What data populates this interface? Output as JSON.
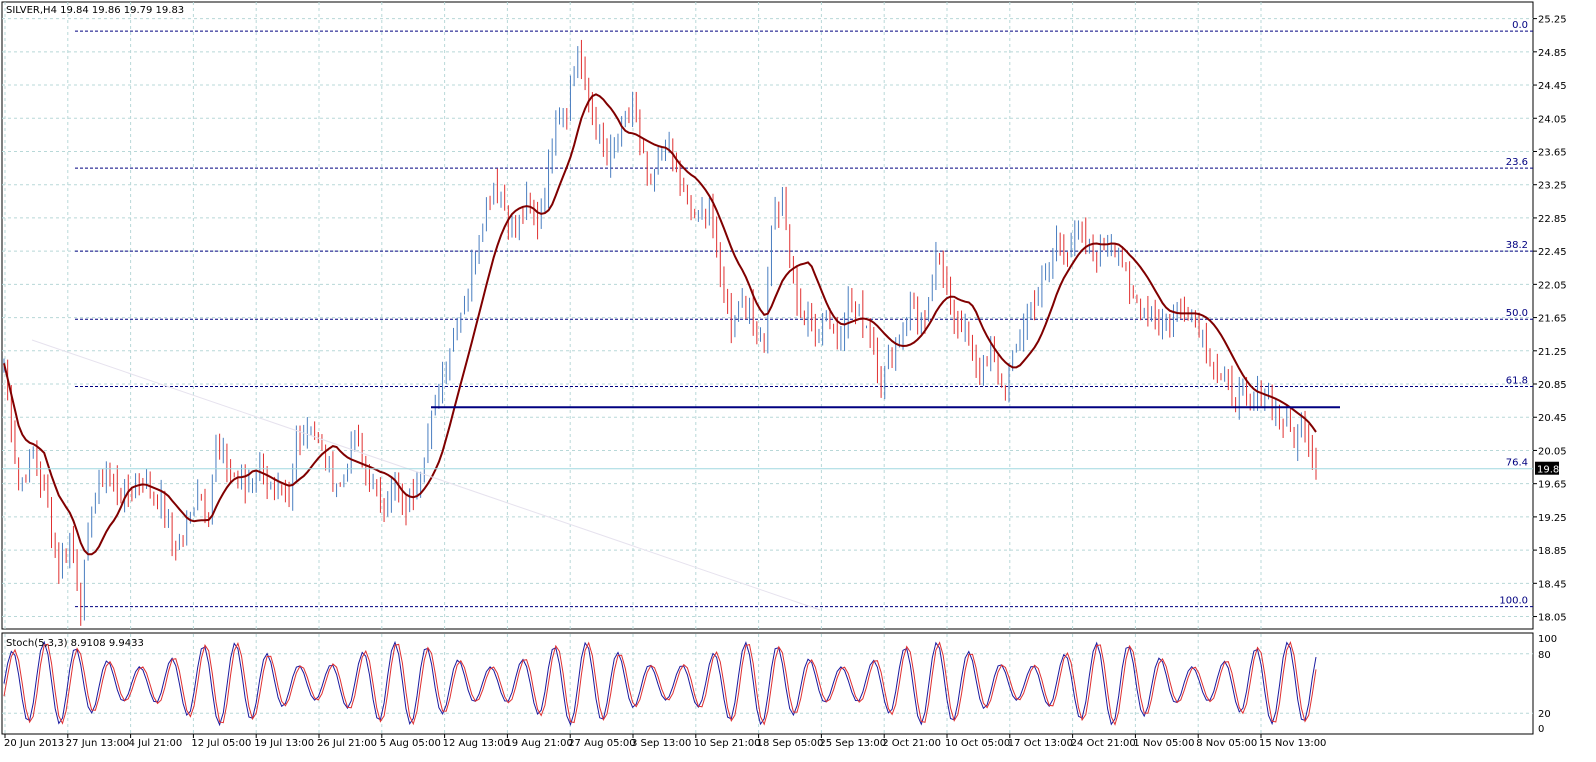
{
  "chart_data": {
    "type": "candlestick",
    "symbol_header": "SILVER,H4  19.84 19.86 19.79 19.83",
    "current_price": "19.83",
    "price_ylim": [
      17.9,
      25.45
    ],
    "price_ticks": [
      "25.25",
      "24.85",
      "24.45",
      "24.05",
      "23.65",
      "23.25",
      "22.85",
      "22.45",
      "22.05",
      "21.65",
      "21.25",
      "20.85",
      "20.45",
      "20.05",
      "19.65",
      "19.25",
      "18.85",
      "18.45",
      "18.05"
    ],
    "x_ticks": [
      "20 Jun 2013",
      "27 Jun 13:00",
      "4 Jul 21:00",
      "12 Jul 05:00",
      "19 Jul 13:00",
      "26 Jul 21:00",
      "5 Aug 05:00",
      "12 Aug 13:00",
      "19 Aug 21:00",
      "27 Aug 05:00",
      "3 Sep 13:00",
      "10 Sep 21:00",
      "18 Sep 05:00",
      "25 Sep 13:00",
      "2 Oct 21:00",
      "10 Oct 05:00",
      "17 Oct 13:00",
      "24 Oct 21:00",
      "1 Nov 05:00",
      "8 Nov 05:00",
      "15 Nov 13:00"
    ],
    "fibonacci": [
      {
        "label": "0.0",
        "price": 25.1
      },
      {
        "label": "23.6",
        "price": 23.45
      },
      {
        "label": "38.2",
        "price": 22.45
      },
      {
        "label": "50.0",
        "price": 21.63
      },
      {
        "label": "61.8",
        "price": 20.82
      },
      {
        "label": "76.4",
        "price": 19.83
      },
      {
        "label": "100.0",
        "price": 18.17
      }
    ],
    "support_level": 20.57,
    "price_anchors": [
      [
        0,
        21.1
      ],
      [
        4,
        19.6
      ],
      [
        8,
        20.0
      ],
      [
        12,
        19.4
      ],
      [
        15,
        18.6
      ],
      [
        18,
        19.0
      ],
      [
        21,
        18.2
      ],
      [
        24,
        19.4
      ],
      [
        28,
        19.8
      ],
      [
        33,
        19.5
      ],
      [
        38,
        19.7
      ],
      [
        43,
        19.4
      ],
      [
        46,
        18.9
      ],
      [
        50,
        19.1
      ],
      [
        53,
        19.6
      ],
      [
        56,
        19.3
      ],
      [
        58,
        20.1
      ],
      [
        62,
        19.8
      ],
      [
        66,
        19.6
      ],
      [
        70,
        19.9
      ],
      [
        74,
        19.5
      ],
      [
        78,
        19.4
      ],
      [
        80,
        20.2
      ],
      [
        84,
        20.4
      ],
      [
        88,
        19.9
      ],
      [
        92,
        19.6
      ],
      [
        96,
        20.2
      ],
      [
        99,
        19.8
      ],
      [
        103,
        19.4
      ],
      [
        107,
        19.6
      ],
      [
        109,
        19.3
      ],
      [
        112,
        19.6
      ],
      [
        116,
        20.2
      ],
      [
        119,
        20.8
      ],
      [
        123,
        21.5
      ],
      [
        127,
        22.0
      ],
      [
        131,
        22.9
      ],
      [
        134,
        23.3
      ],
      [
        137,
        23.0
      ],
      [
        140,
        22.7
      ],
      [
        143,
        23.0
      ],
      [
        146,
        22.8
      ],
      [
        149,
        23.4
      ],
      [
        151,
        24.1
      ],
      [
        154,
        24.2
      ],
      [
        157,
        24.9
      ],
      [
        159,
        24.4
      ],
      [
        162,
        24.0
      ],
      [
        165,
        23.5
      ],
      [
        169,
        23.9
      ],
      [
        172,
        24.2
      ],
      [
        174,
        23.7
      ],
      [
        177,
        23.2
      ],
      [
        181,
        23.8
      ],
      [
        184,
        23.4
      ],
      [
        187,
        23.0
      ],
      [
        190,
        22.8
      ],
      [
        193,
        23.0
      ],
      [
        196,
        22.1
      ],
      [
        199,
        21.6
      ],
      [
        202,
        21.9
      ],
      [
        205,
        21.6
      ],
      [
        208,
        21.4
      ],
      [
        210,
        22.8
      ],
      [
        213,
        23.0
      ],
      [
        216,
        22.1
      ],
      [
        219,
        21.6
      ],
      [
        222,
        21.5
      ],
      [
        225,
        21.7
      ],
      [
        228,
        21.4
      ],
      [
        231,
        21.8
      ],
      [
        234,
        21.7
      ],
      [
        237,
        21.5
      ],
      [
        240,
        20.8
      ],
      [
        243,
        21.3
      ],
      [
        246,
        21.6
      ],
      [
        249,
        21.8
      ],
      [
        252,
        21.5
      ],
      [
        255,
        22.3
      ],
      [
        258,
        22.1
      ],
      [
        261,
        21.5
      ],
      [
        264,
        21.4
      ],
      [
        267,
        21.0
      ],
      [
        270,
        21.2
      ],
      [
        273,
        20.8
      ],
      [
        276,
        21.1
      ],
      [
        279,
        21.6
      ],
      [
        282,
        21.9
      ],
      [
        285,
        22.1
      ],
      [
        288,
        22.6
      ],
      [
        291,
        22.5
      ],
      [
        294,
        22.7
      ],
      [
        297,
        22.4
      ],
      [
        300,
        22.5
      ],
      [
        303,
        22.6
      ],
      [
        305,
        22.5
      ],
      [
        308,
        21.9
      ],
      [
        311,
        21.8
      ],
      [
        314,
        21.7
      ],
      [
        317,
        21.6
      ],
      [
        320,
        21.7
      ],
      [
        323,
        21.8
      ],
      [
        326,
        21.7
      ],
      [
        329,
        21.3
      ],
      [
        332,
        21.0
      ],
      [
        335,
        20.8
      ],
      [
        338,
        20.7
      ],
      [
        341,
        20.6
      ],
      [
        344,
        20.8
      ],
      [
        347,
        20.6
      ],
      [
        350,
        20.4
      ],
      [
        353,
        20.2
      ],
      [
        356,
        20.4
      ],
      [
        359,
        19.83
      ]
    ],
    "stoch_ylim": [
      0,
      100
    ],
    "stoch_ticks": [
      "100",
      "80",
      "20",
      "0"
    ],
    "stoch_label": "Stoch(5,3,3) 8.9108 9.9433"
  }
}
